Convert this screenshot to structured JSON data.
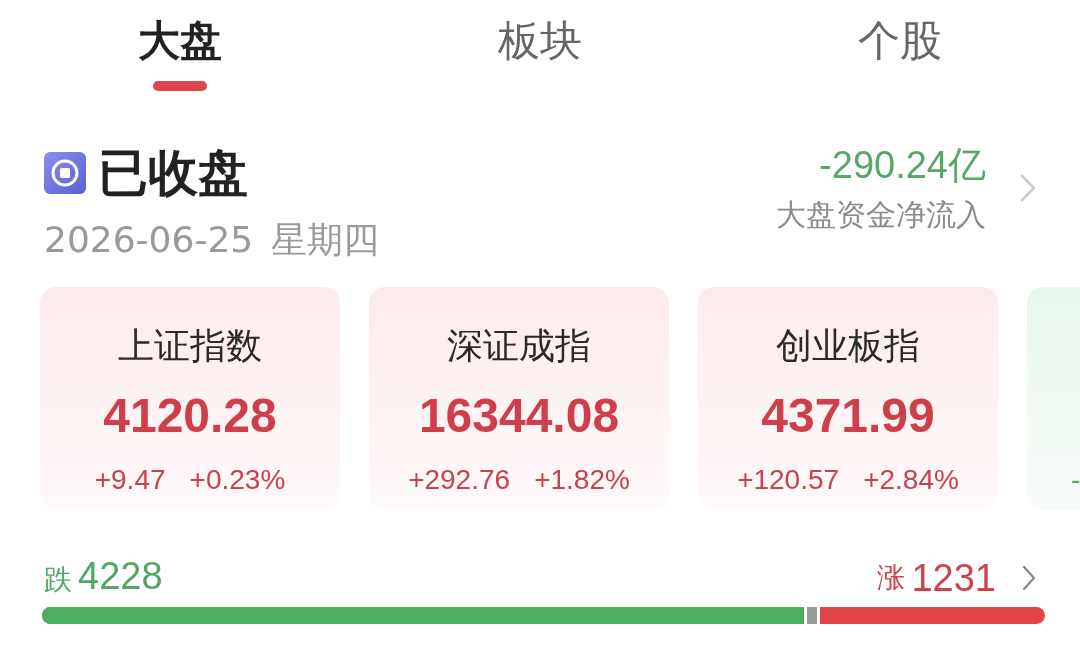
{
  "tabs": [
    {
      "label": "大盘",
      "selected": true
    },
    {
      "label": "板块",
      "selected": false
    },
    {
      "label": "个股",
      "selected": false
    }
  ],
  "market_status": {
    "title": "已收盘",
    "date": "2026-06-25",
    "weekday": "星期四"
  },
  "net_inflow": {
    "value": "-290.24亿",
    "label": "大盘资金净流入",
    "rising": false
  },
  "index_cards": [
    {
      "name": "上证指数",
      "value": "4120.28",
      "change": "+9.47",
      "percent": "+0.23%",
      "rising": true
    },
    {
      "name": "深证成指",
      "value": "16344.08",
      "change": "+292.76",
      "percent": "+1.82%",
      "rising": true
    },
    {
      "name": "创业板指",
      "value": "4371.99",
      "change": "+120.57",
      "percent": "+2.84%",
      "rising": true
    },
    {
      "change": "-",
      "rising": false
    }
  ],
  "breadth": {
    "fall_label": "跌",
    "fall_count": "4228",
    "rise_label": "涨",
    "rise_count": "1231",
    "level": 0.776
  }
}
